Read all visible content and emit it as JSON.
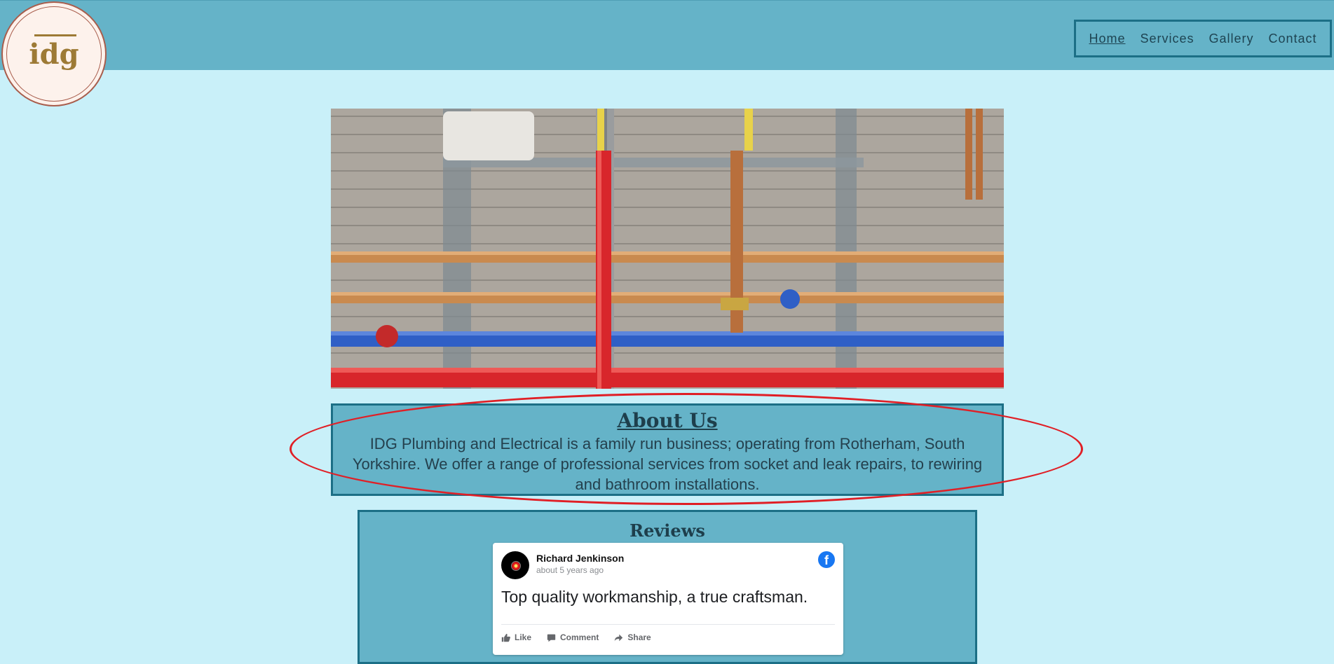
{
  "logo": {
    "text": "idg"
  },
  "nav": {
    "items": [
      {
        "label": "Home",
        "active": true
      },
      {
        "label": "Services",
        "active": false
      },
      {
        "label": "Gallery",
        "active": false
      },
      {
        "label": "Contact",
        "active": false
      }
    ]
  },
  "about": {
    "title": "About Us",
    "text": "IDG Plumbing and Electrical is a family run business; operating from Rotherham, South Yorkshire. We offer a range of professional services from socket and leak repairs, to rewiring and bathroom installations."
  },
  "reviews": {
    "title": "Reviews",
    "items": [
      {
        "name": "Richard Jenkinson",
        "time": "about 5 years ago",
        "text": "Top quality workmanship, a true craftsman.",
        "actions": {
          "like": "Like",
          "comment": "Comment",
          "share": "Share"
        }
      }
    ]
  },
  "colors": {
    "page_bg": "#c9f0f9",
    "header_bg": "#65b3c8",
    "nav_border": "#1c6f86",
    "logo_text": "#9d7a35",
    "annotation": "#e01f26",
    "facebook": "#1877f2"
  },
  "icons": [
    "logo-icon",
    "facebook-icon",
    "like-icon",
    "comment-icon",
    "share-icon"
  ]
}
